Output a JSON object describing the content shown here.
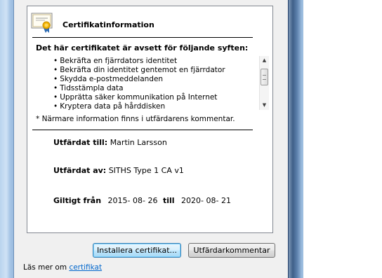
{
  "window": {
    "icon": "certificate-icon"
  },
  "header": {
    "title": "Certifikatinformation"
  },
  "purposes": {
    "heading": "Det här certifikatet är avsett för följande syften:",
    "items": [
      "Bekräfta en fjärrdators identitet",
      "Bekräfta din identitet gentemot en fjärrdator",
      "Skydda e-postmeddelanden",
      "Tidsstämpla data",
      "Upprätta säker kommunikation på Internet",
      "Kryptera data på hårddisken"
    ],
    "note": "* Närmare information finns i utfärdarens kommentar."
  },
  "details": {
    "issued_to_label": "Utfärdat till:",
    "issued_to": "Martin Larsson",
    "issued_by_label": "Utfärdat av:",
    "issued_by": "SITHS Type 1 CA v1",
    "valid_from_label": "Giltigt från",
    "valid_from": "2015- 08- 26",
    "valid_to_label": "till",
    "valid_to": "2020- 08- 21"
  },
  "buttons": {
    "install": "Installera certifikat...",
    "issuer_statement": "Utfärdarkommentar"
  },
  "footer": {
    "learn_more_prefix": "Läs mer om",
    "learn_more_link": "certifikat"
  },
  "colors": {
    "link": "#0066cc",
    "frame": "#9cbde0",
    "dialog_background": "#f0f0f0"
  }
}
